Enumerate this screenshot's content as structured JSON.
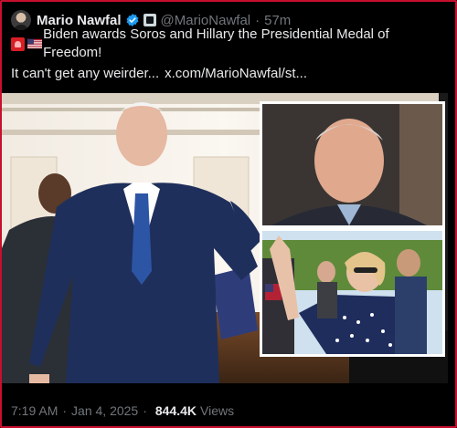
{
  "author": {
    "name": "Mario Nawfal",
    "handle": "@MarioNawfal",
    "separator": "·",
    "time_ago": "57m",
    "verified_icon": "verified-badge-icon",
    "affiliation_icon": "affiliate-badge-icon"
  },
  "tweet": {
    "line1": "Biden awards Soros and Hillary the Presidential Medal of Freedom!",
    "line2": "It can't get any weirder...",
    "link": "x.com/MarioNawfal/st..."
  },
  "meta": {
    "time": "7:19 AM",
    "date": "Jan 4, 2025",
    "views_count": "844.4K",
    "views_label": "Views"
  },
  "colors": {
    "frame_border": "#c8102e",
    "background": "#000000",
    "text": "#e7e9ea",
    "muted": "#71767b",
    "verified": "#1d9bf0"
  }
}
